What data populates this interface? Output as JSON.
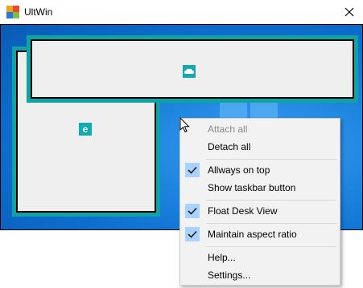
{
  "window": {
    "title": "UltWin",
    "close_glyph": "✕",
    "icon": "ultwin-app-icon"
  },
  "desk": {
    "wallpaper": "windows-10-blue",
    "thumbnails": [
      {
        "name": "edge",
        "icon_glyph": "e",
        "icon": "edge-icon"
      },
      {
        "name": "app",
        "icon_glyph": "☁",
        "icon": "weather-app-icon"
      }
    ]
  },
  "context_menu": {
    "items": [
      {
        "label": "Attach all",
        "enabled": false,
        "checked": false
      },
      {
        "label": "Detach all",
        "enabled": true,
        "checked": false
      },
      {
        "label": "Allways on top",
        "enabled": true,
        "checked": true
      },
      {
        "label": "Show taskbar button",
        "enabled": true,
        "checked": false
      },
      {
        "label": "Float Desk View",
        "enabled": true,
        "checked": true
      },
      {
        "label": "Maintain aspect ratio",
        "enabled": true,
        "checked": true
      },
      {
        "label": "Help...",
        "enabled": true,
        "checked": false
      },
      {
        "label": "Settings...",
        "enabled": true,
        "checked": false
      }
    ]
  },
  "colors": {
    "thumb_frame": "#10a3a3",
    "check_bg": "#a9d3ff",
    "menu_bg": "#f2f2f2"
  }
}
